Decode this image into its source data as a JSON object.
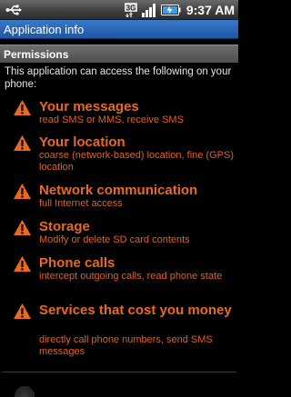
{
  "status_bar": {
    "signal_badge": "3G",
    "time": "9:37 AM",
    "icons": [
      "usb-icon",
      "network-3g-icon",
      "signal-bars-icon",
      "battery-icon"
    ]
  },
  "title_bar": {
    "title": "Application info"
  },
  "permissions": {
    "header": "Permissions",
    "intro": "This application can access the following on your phone:",
    "items": [
      {
        "title": "Your messages",
        "description": "read SMS or MMS, receive SMS"
      },
      {
        "title": "Your location",
        "description": "coarse (network-based) location, fine (GPS) location"
      },
      {
        "title": "Network communication",
        "description": "full Internet access"
      },
      {
        "title": "Storage",
        "description": "Modify or delete SD card contents"
      },
      {
        "title": "Phone calls",
        "description": "intercept outgoing calls, read phone state"
      },
      {
        "title": "Services that cost you money",
        "description": "directly call phone numbers, send SMS messages"
      }
    ]
  },
  "colors": {
    "warning_orange": "#e86a22",
    "title_blue": "#2a66b8"
  }
}
